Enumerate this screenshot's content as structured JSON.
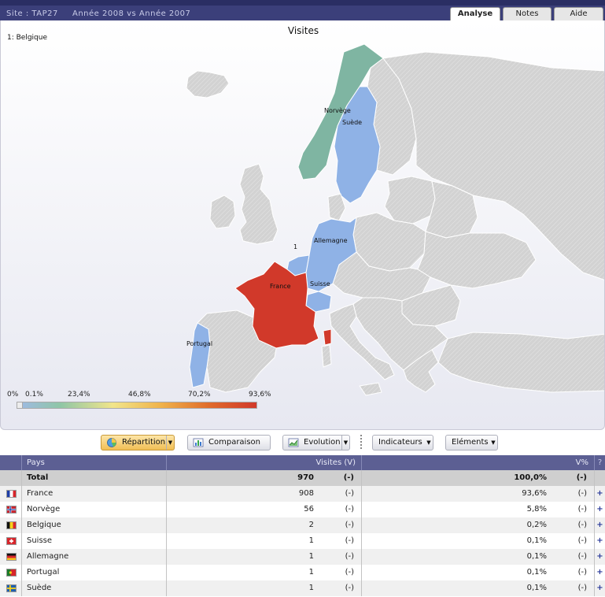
{
  "header": {
    "site": "Site : TAP27",
    "period": "Année 2008 vs Année 2007",
    "tabs": [
      {
        "label": "Analyse",
        "active": true
      },
      {
        "label": "Notes",
        "active": false
      },
      {
        "label": "Aide",
        "active": false
      }
    ]
  },
  "map": {
    "title": "Visites",
    "note": "1: Belgique",
    "labels": {
      "norvege": "Norvège",
      "suede": "Suède",
      "allemagne": "Allemagne",
      "belgique": "1",
      "france": "France",
      "suisse": "Suisse",
      "portugal": "Portugal"
    },
    "scale": [
      "0%",
      "0.1%",
      "23,4%",
      "46,8%",
      "70,2%",
      "93,6%"
    ],
    "colors": {
      "top": "#d1392a",
      "mid": "#7fb5a2",
      "low": "#8fb2e6",
      "none": "#d4d4d4"
    }
  },
  "toolbar": {
    "repartition": "Répartition",
    "comparaison": "Comparaison",
    "evolution": "Evolution",
    "indicateurs": "Indicateurs",
    "elements": "Eléments"
  },
  "table": {
    "headers": {
      "pays": "Pays",
      "visites": "Visites (V)",
      "pct": "V%",
      "help": "?"
    },
    "total": {
      "label": "Total",
      "visites": "970",
      "visites_change": "(-)",
      "pct": "100,0%",
      "pct_change": "(-)"
    },
    "rows": [
      {
        "flag": "fr",
        "pays": "France",
        "visites": "908",
        "visites_change": "(-)",
        "pct": "93,6%",
        "pct_change": "(-)"
      },
      {
        "flag": "no",
        "pays": "Norvège",
        "visites": "56",
        "visites_change": "(-)",
        "pct": "5,8%",
        "pct_change": "(-)"
      },
      {
        "flag": "be",
        "pays": "Belgique",
        "visites": "2",
        "visites_change": "(-)",
        "pct": "0,2%",
        "pct_change": "(-)"
      },
      {
        "flag": "ch",
        "pays": "Suisse",
        "visites": "1",
        "visites_change": "(-)",
        "pct": "0,1%",
        "pct_change": "(-)"
      },
      {
        "flag": "de",
        "pays": "Allemagne",
        "visites": "1",
        "visites_change": "(-)",
        "pct": "0,1%",
        "pct_change": "(-)"
      },
      {
        "flag": "pt",
        "pays": "Portugal",
        "visites": "1",
        "visites_change": "(-)",
        "pct": "0,1%",
        "pct_change": "(-)"
      },
      {
        "flag": "se",
        "pays": "Suède",
        "visites": "1",
        "visites_change": "(-)",
        "pct": "0,1%",
        "pct_change": "(-)"
      }
    ],
    "expand_symbol": "+"
  }
}
